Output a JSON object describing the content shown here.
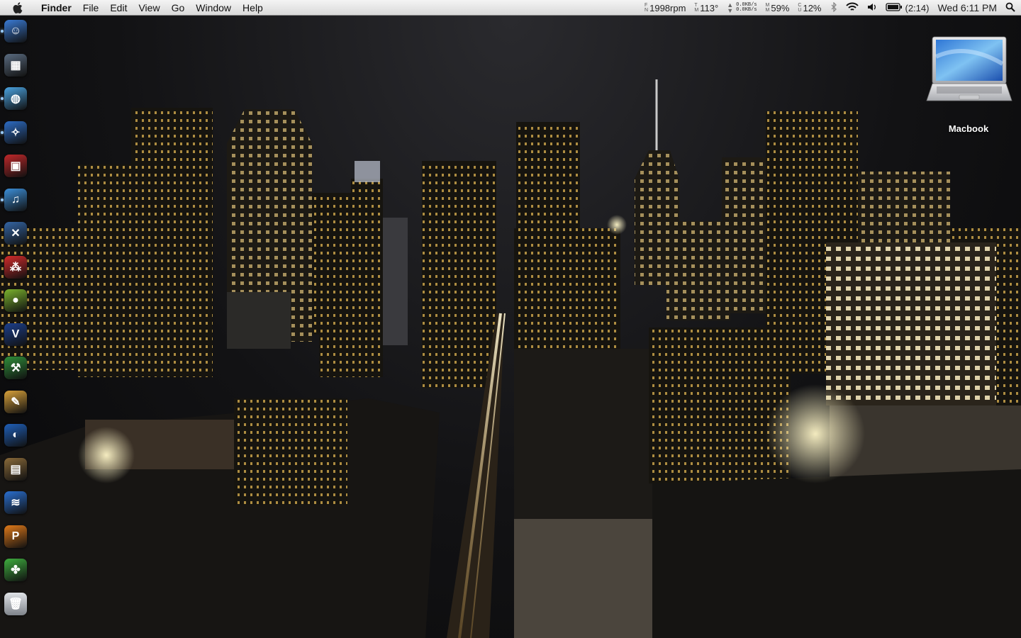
{
  "menubar": {
    "app_name": "Finder",
    "menus": [
      "File",
      "Edit",
      "View",
      "Go",
      "Window",
      "Help"
    ],
    "fan_label_top": "F",
    "fan_label_bottom": "N",
    "fan_speed": "1998rpm",
    "temp_label_top": "T",
    "temp_label_bottom": "M",
    "temperature": "113°",
    "net_up": "0.0KB/s",
    "net_down": "0.0KB/s",
    "mem_label_top": "M",
    "mem_label_bottom": "M",
    "memory": "59%",
    "cpu_label_top": "C",
    "cpu_label_bottom": "U",
    "cpu": "12%",
    "battery_time": "(2:14)",
    "clock": "Wed 6:11 PM"
  },
  "icons": {
    "apple": "apple-icon",
    "bluetooth": "bluetooth-icon",
    "wifi": "wifi-icon",
    "volume": "volume-icon",
    "battery": "battery-icon",
    "spotlight": "spotlight-icon"
  },
  "dock": {
    "items": [
      {
        "name": "finder",
        "color": "#3a7bd5",
        "glyph": "☺",
        "running": true
      },
      {
        "name": "dashboard-widgets",
        "color": "#5a6b80",
        "glyph": "▦",
        "running": false
      },
      {
        "name": "ichat",
        "color": "#4aa3e0",
        "glyph": "◍",
        "running": true
      },
      {
        "name": "safari",
        "color": "#2d6cc4",
        "glyph": "✧",
        "running": true
      },
      {
        "name": "photo-booth",
        "color": "#c0282a",
        "glyph": "▣",
        "running": false
      },
      {
        "name": "itunes",
        "color": "#3c8fd8",
        "glyph": "♫",
        "running": true
      },
      {
        "name": "xcode",
        "color": "#3465a4",
        "glyph": "✕",
        "running": false
      },
      {
        "name": "app-red",
        "color": "#d22b2b",
        "glyph": "⁂",
        "running": false
      },
      {
        "name": "app-green",
        "color": "#7bb32e",
        "glyph": "●",
        "running": false
      },
      {
        "name": "vlc-v",
        "color": "#1c3f8c",
        "glyph": "V",
        "running": false
      },
      {
        "name": "app-tool",
        "color": "#2f8f3a",
        "glyph": "⚒",
        "running": false
      },
      {
        "name": "paintbrush",
        "color": "#d9a23a",
        "glyph": "✎",
        "running": false
      },
      {
        "name": "google-earth",
        "color": "#1f5fb8",
        "glyph": "◐",
        "running": false
      },
      {
        "name": "iphoto",
        "color": "#8a6a3a",
        "glyph": "▤",
        "running": false
      },
      {
        "name": "app-blue-wave",
        "color": "#2a6fd0",
        "glyph": "≋",
        "running": false
      },
      {
        "name": "app-orange",
        "color": "#e07a1a",
        "glyph": "P",
        "running": false
      },
      {
        "name": "app-green-figure",
        "color": "#3fae3f",
        "glyph": "✤",
        "running": false
      },
      {
        "name": "trash",
        "color": "#9a9ea4",
        "glyph": "🗑",
        "running": false
      }
    ]
  },
  "desktop": {
    "icon_label": "Macbook"
  }
}
